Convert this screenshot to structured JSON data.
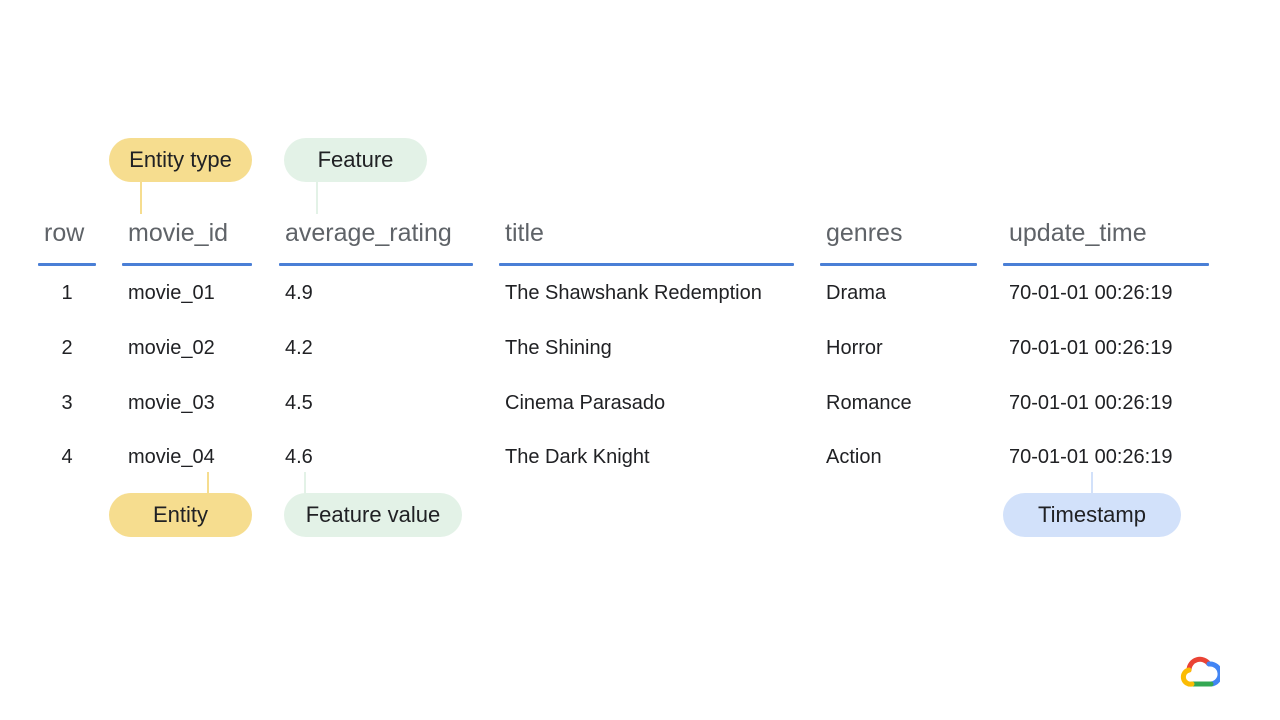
{
  "columns": [
    {
      "key": "row",
      "label": "row"
    },
    {
      "key": "movie_id",
      "label": "movie_id"
    },
    {
      "key": "average_rating",
      "label": "average_rating"
    },
    {
      "key": "title",
      "label": "title"
    },
    {
      "key": "genres",
      "label": "genres"
    },
    {
      "key": "update_time",
      "label": "update_time"
    }
  ],
  "rows": [
    {
      "row": "1",
      "movie_id": "movie_01",
      "average_rating": "4.9",
      "title": "The Shawshank Redemption",
      "genres": "Drama",
      "update_time": "70-01-01 00:26:19"
    },
    {
      "row": "2",
      "movie_id": "movie_02",
      "average_rating": "4.2",
      "title": "The Shining",
      "genres": "Horror",
      "update_time": "70-01-01 00:26:19"
    },
    {
      "row": "3",
      "movie_id": "movie_03",
      "average_rating": "4.5",
      "title": "Cinema Parasado",
      "genres": "Romance",
      "update_time": "70-01-01 00:26:19"
    },
    {
      "row": "4",
      "movie_id": "movie_04",
      "average_rating": "4.6",
      "title": "The Dark Knight",
      "genres": "Action",
      "update_time": "70-01-01 00:26:19"
    }
  ],
  "annotations": {
    "entity_type": "Entity type",
    "feature": "Feature",
    "entity": "Entity",
    "feature_value": "Feature value",
    "timestamp": "Timestamp"
  },
  "colors": {
    "header_rule": "#4a7fd6",
    "pill_yellow": "#f6dd8f",
    "pill_green": "#e3f2e7",
    "pill_blue": "#d2e1fa"
  },
  "logo": {
    "icon": "google-cloud-logo-icon"
  }
}
